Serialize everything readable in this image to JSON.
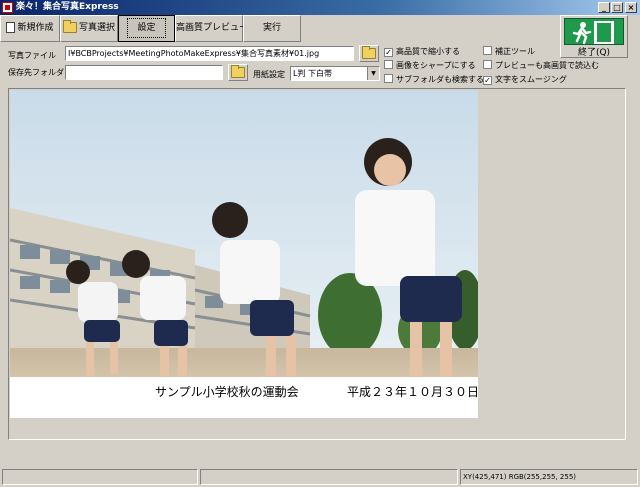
{
  "window": {
    "title": "楽々！集合写真Express"
  },
  "toolbar": {
    "new_label": "新規作成",
    "select_label": "写真選択",
    "settings_label": "設定",
    "preview_label": "高画質プレビュー",
    "run_label": "実行"
  },
  "exit": {
    "label": "終了(Q)"
  },
  "form": {
    "photo_file_label": "写真ファイル",
    "photo_file_value": "I¥BCBProjects¥MeetingPhotoMakeExpress¥集合写真素材¥01.jpg",
    "save_folder_label": "保存先フォルダ",
    "save_folder_value": "",
    "paper_label": "用紙設定",
    "paper_value": "L判 下白帯"
  },
  "options": [
    {
      "label": "高品質で縮小する",
      "checked": true
    },
    {
      "label": "画像をシャープにする",
      "checked": false
    },
    {
      "label": "サブフォルダも検索する",
      "checked": false
    },
    {
      "label": "補正ツール",
      "checked": false
    },
    {
      "label": "プレビューも高画質で読込む",
      "checked": false
    },
    {
      "label": "文字をスムージング",
      "checked": true
    }
  ],
  "caption": {
    "school": "サンプル小学校秋の運動会",
    "date": "平成２３年１０月３０日"
  },
  "status": {
    "readout": "XY(425,471) RGB(255,255, 255)"
  },
  "colors": {
    "titlebar": "#0a246a",
    "face": "#d4d0c8",
    "exit_sign": "#1f9a4c"
  },
  "icons": [
    "new-document-icon",
    "folder-icon",
    "exit-sign-icon",
    "checkmark-icon"
  ]
}
